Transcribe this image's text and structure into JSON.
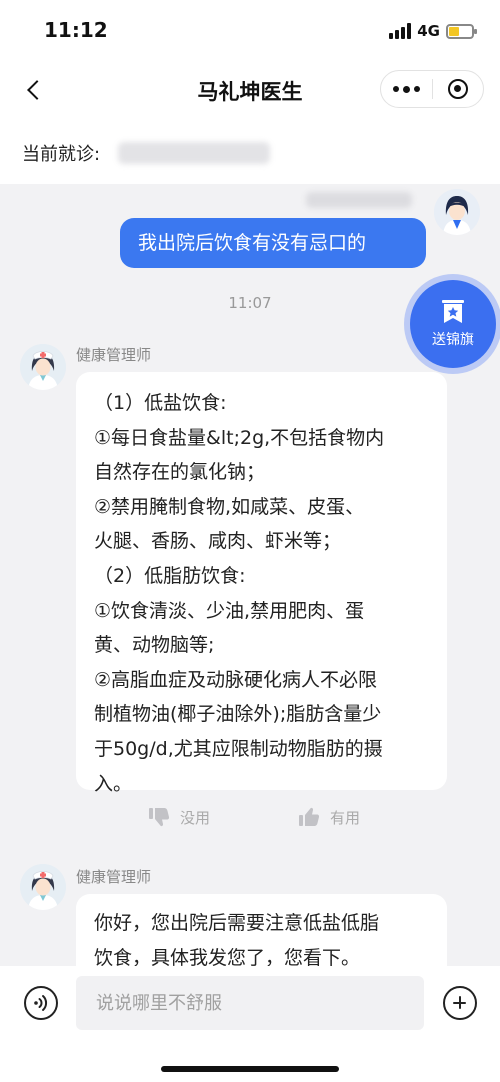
{
  "status_bar": {
    "time": "11:12",
    "network": "4G",
    "battery_level": 0.45
  },
  "nav": {
    "title": "马礼坤医生",
    "back_icon": "chevron-left-icon",
    "more_icon": "more-dots-icon",
    "close_icon": "target-close-icon"
  },
  "visit": {
    "label": "当前就诊:"
  },
  "chat": {
    "user_message": "我出院后饮食有没有忌口的",
    "timestamp": "11:07",
    "banner_button": {
      "label": "送锦旗",
      "icon": "banner-flag-icon"
    },
    "staff_name": "健康管理师",
    "reply_lines": [
      "（1）低盐饮食:",
      "①每日食盐量&lt;2g,不包括食物内",
      "自然存在的氯化钠；",
      "②禁用腌制食物,如咸菜、皮蛋、",
      "火腿、香肠、咸肉、虾米等；",
      "（2）低脂肪饮食:",
      "①饮食清淡、少油,禁用肥肉、蛋",
      "黄、动物脑等;",
      "②高脂血症及动脉硬化病人不必限",
      "制植物油(椰子油除外);脂肪含量少",
      "于50g/d,尤其应限制动物脂肪的摄",
      "入。"
    ],
    "feedback": {
      "useless": "没用",
      "useful": "有用"
    },
    "second_message_lines": [
      "你好，您出院后需要注意低盐低脂",
      "饮食，具体我发您了，您看下。"
    ]
  },
  "input_bar": {
    "placeholder": "说说哪里不舒服",
    "voice_icon": "voice-icon",
    "plus_icon": "plus-icon"
  },
  "colors": {
    "accent": "#3b78f0",
    "chat_bg": "#f2f2f4",
    "bubble": "#ffffff"
  }
}
